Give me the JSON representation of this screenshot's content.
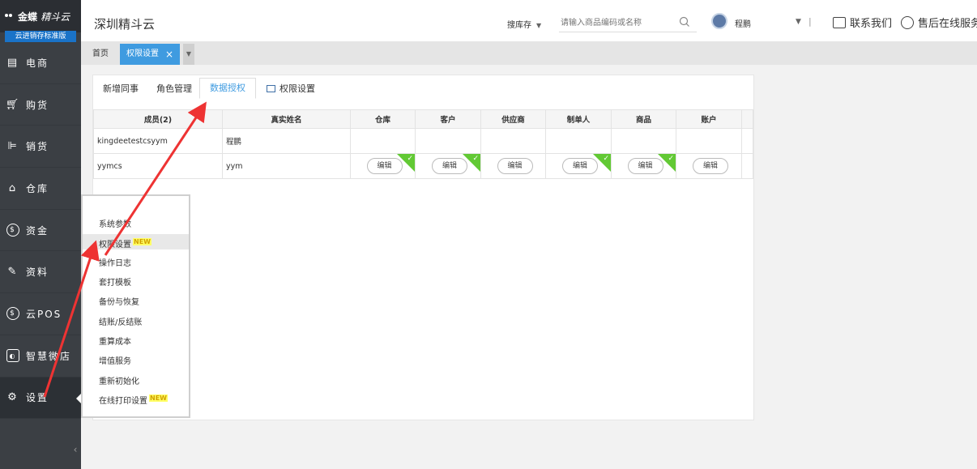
{
  "sidebar": {
    "brand_name": "金蝶",
    "brand_sub": "精斗云",
    "edition": "云进销存标准版",
    "items": [
      {
        "label": "电商",
        "icon": "store-icon"
      },
      {
        "label": "购货",
        "icon": "cart-icon"
      },
      {
        "label": "销货",
        "icon": "sell-icon"
      },
      {
        "label": "仓库",
        "icon": "warehouse-icon"
      },
      {
        "label": "资金",
        "icon": "money-icon"
      },
      {
        "label": "资料",
        "icon": "pencil-icon"
      },
      {
        "label": "云POS",
        "icon": "pos-icon"
      },
      {
        "label": "智慧微店",
        "icon": "shop-icon"
      },
      {
        "label": "设置",
        "icon": "gear-icon"
      }
    ]
  },
  "header": {
    "company": "深圳精斗云",
    "search_type": "搜库存",
    "search_placeholder": "请输入商品编码或名称",
    "user_name": "程鹏",
    "divider": "|",
    "contact": "联系我们",
    "service": "售后在线服务"
  },
  "tabs": {
    "home": "首页",
    "active": "权限设置",
    "close": "×"
  },
  "subtabs": {
    "new_colleague": "新增同事",
    "role_manage": "角色管理",
    "data_auth": "数据授权",
    "perm_settings": "权限设置"
  },
  "table": {
    "headers": [
      "成员(2)",
      "真实姓名",
      "仓库",
      "客户",
      "供应商",
      "制单人",
      "商品",
      "账户"
    ],
    "rows": [
      {
        "member": "kingdeetestcsyym",
        "real_name": "程鹏"
      },
      {
        "member": "yymcs",
        "real_name": "yym"
      }
    ],
    "edit_label": "编辑"
  },
  "menu": {
    "items": [
      "系统参数",
      "权限设置",
      "操作日志",
      "套打模板",
      "备份与恢复",
      "结账/反结账",
      "重算成本",
      "增值服务",
      "重新初始化",
      "在线打印设置"
    ],
    "new_badge": "NEW"
  },
  "colors": {
    "sidebar_bg": "#3b3f44",
    "accent": "#3f9be0",
    "check_green": "#62c934",
    "arrow_red": "#ee3333"
  }
}
